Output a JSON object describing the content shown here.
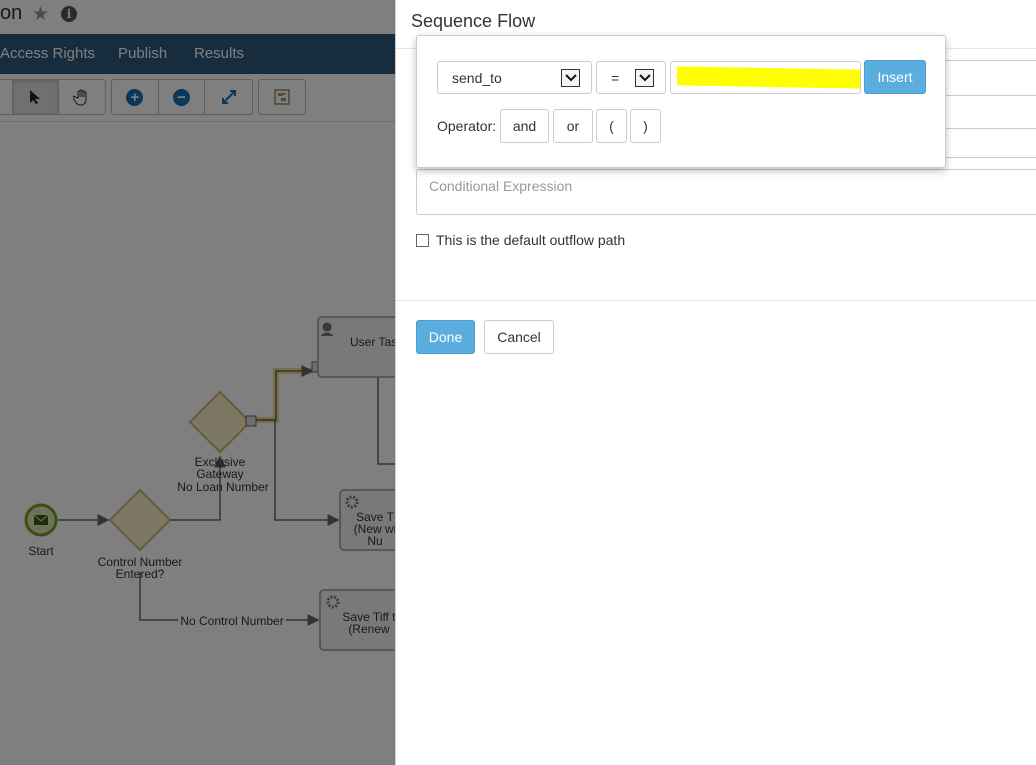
{
  "app": {
    "title_fragment": "on",
    "nav": [
      "Access Rights",
      "Publish",
      "Results"
    ]
  },
  "diagram": {
    "labels": {
      "start": "Start",
      "control_number": "Control Number Entered?",
      "exclusive_gateway": "Exclusive Gateway",
      "no_loan_number": "No Loan Number",
      "user_task": "User Tas",
      "save_tiff_new": "Save T (New wi Nu",
      "save_tiff_renew": "Save Tiff t (Renew",
      "no_control_number": "No Control Number"
    }
  },
  "panel": {
    "title": "Sequence Flow",
    "conditional_placeholder": "Conditional Expression",
    "default_path_label": "This is the default outflow path",
    "default_path_checked": false,
    "done_label": "Done",
    "cancel_label": "Cancel"
  },
  "builder": {
    "field_value": "send_to",
    "operator_value": "=",
    "insert_label": "Insert",
    "operator_label": "Operator:",
    "operators": [
      "and",
      "or",
      "(",
      ")"
    ]
  },
  "colors": {
    "navbar": "#2f5a7a",
    "primary_button": "#5bade0",
    "highlight": "#ffff00"
  }
}
